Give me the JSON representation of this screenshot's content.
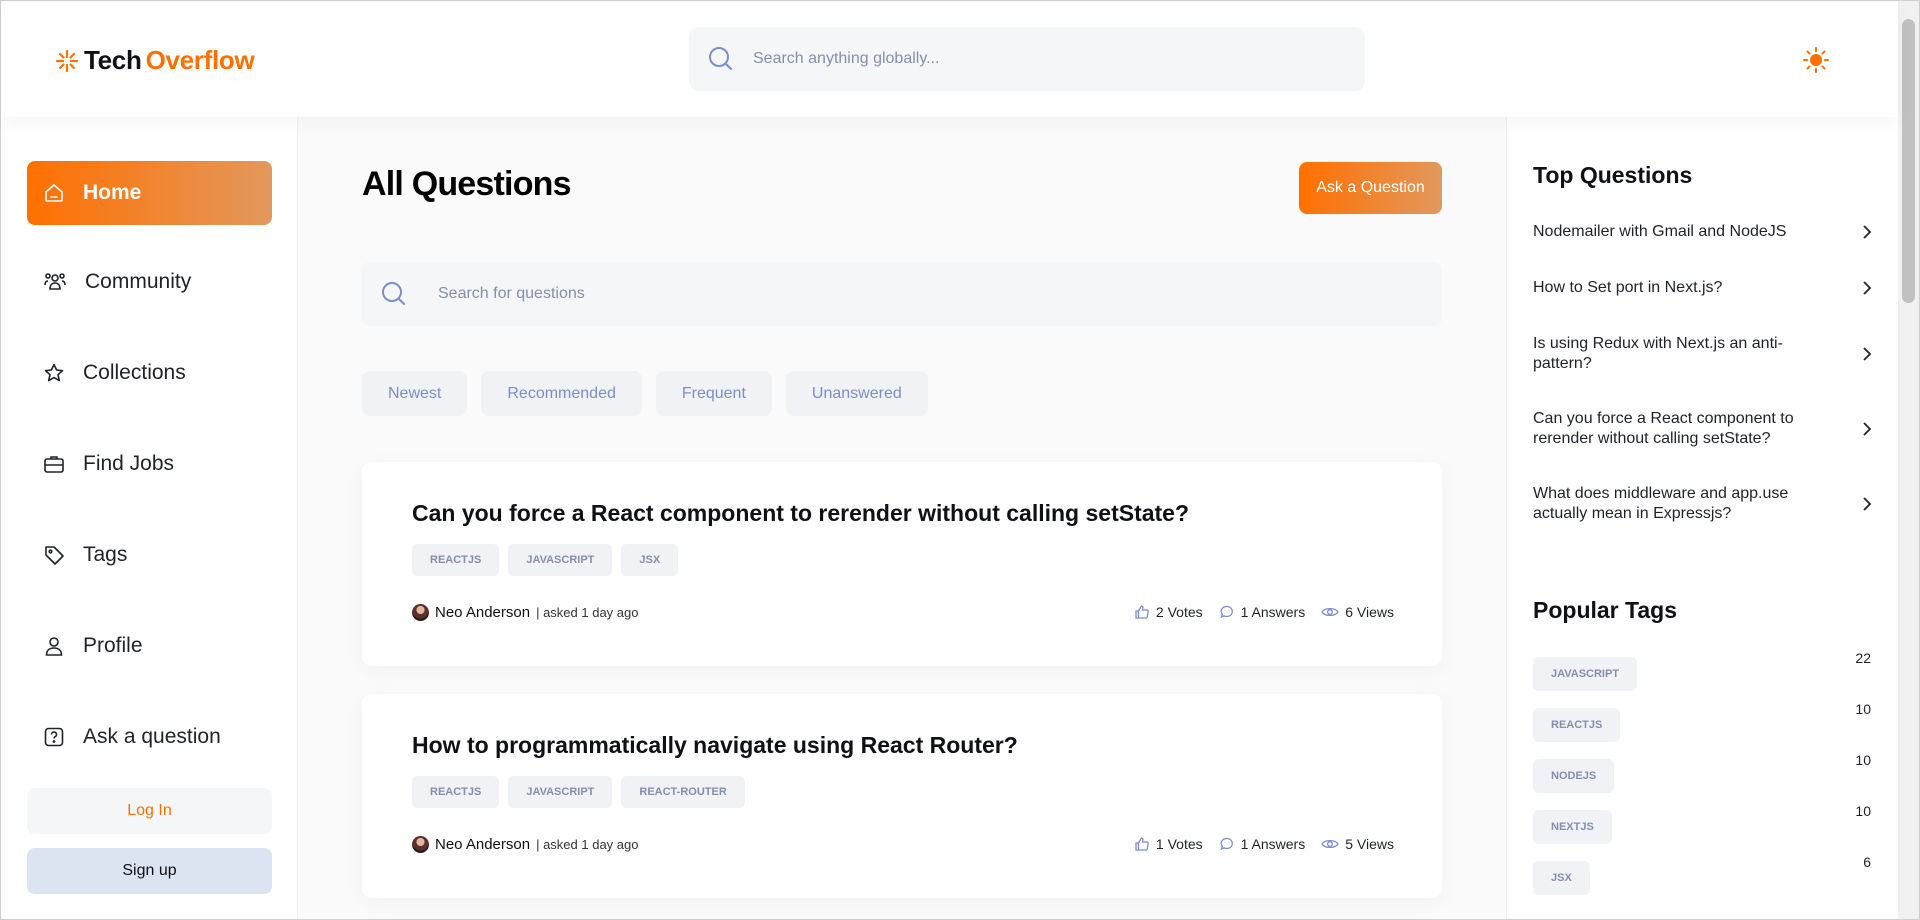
{
  "brand": {
    "name_part1": "Tech",
    "name_part2": "Overflow",
    "accent_color": "#ff7000"
  },
  "header": {
    "search_placeholder": "Search anything globally...",
    "theme_icon": "sun-icon"
  },
  "sidebar": {
    "items": [
      {
        "label": "Home",
        "icon": "home-icon",
        "active": true
      },
      {
        "label": "Community",
        "icon": "users-icon"
      },
      {
        "label": "Collections",
        "icon": "star-icon"
      },
      {
        "label": "Find Jobs",
        "icon": "suitcase-icon"
      },
      {
        "label": "Tags",
        "icon": "tag-icon"
      },
      {
        "label": "Profile",
        "icon": "user-icon"
      },
      {
        "label": "Ask a question",
        "icon": "question-icon"
      }
    ],
    "login_label": "Log In",
    "signup_label": "Sign up"
  },
  "main": {
    "title": "All Questions",
    "ask_button": "Ask a Question",
    "search_placeholder": "Search for questions",
    "filters": [
      "Newest",
      "Recommended",
      "Frequent",
      "Unanswered"
    ],
    "questions": [
      {
        "title": "Can you force a React component to rerender without calling setState?",
        "tags": [
          "REACTJS",
          "JAVASCRIPT",
          "JSX"
        ],
        "author": "Neo Anderson",
        "asked": "| asked 1 day ago",
        "votes": "2 Votes",
        "answers": "1 Answers",
        "views": "6 Views"
      },
      {
        "title": "How to programmatically navigate using React Router?",
        "tags": [
          "REACTJS",
          "JAVASCRIPT",
          "REACT-ROUTER"
        ],
        "author": "Neo Anderson",
        "asked": "| asked 1 day ago",
        "votes": "1 Votes",
        "answers": "1 Answers",
        "views": "5 Views"
      }
    ]
  },
  "rightbar": {
    "top_questions_title": "Top Questions",
    "top_questions": [
      "Nodemailer with Gmail and NodeJS",
      "How to Set port in Next.js?",
      "Is using Redux with Next.js an anti-pattern?",
      "Can you force a React component to rerender without calling setState?",
      "What does middleware and app.use actually mean in Expressjs?"
    ],
    "popular_tags_title": "Popular Tags",
    "popular_tags": [
      {
        "name": "JAVASCRIPT",
        "count": "22"
      },
      {
        "name": "REACTJS",
        "count": "10"
      },
      {
        "name": "NODEJS",
        "count": "10"
      },
      {
        "name": "NEXTJS",
        "count": "10"
      },
      {
        "name": "JSX",
        "count": "6"
      }
    ]
  }
}
